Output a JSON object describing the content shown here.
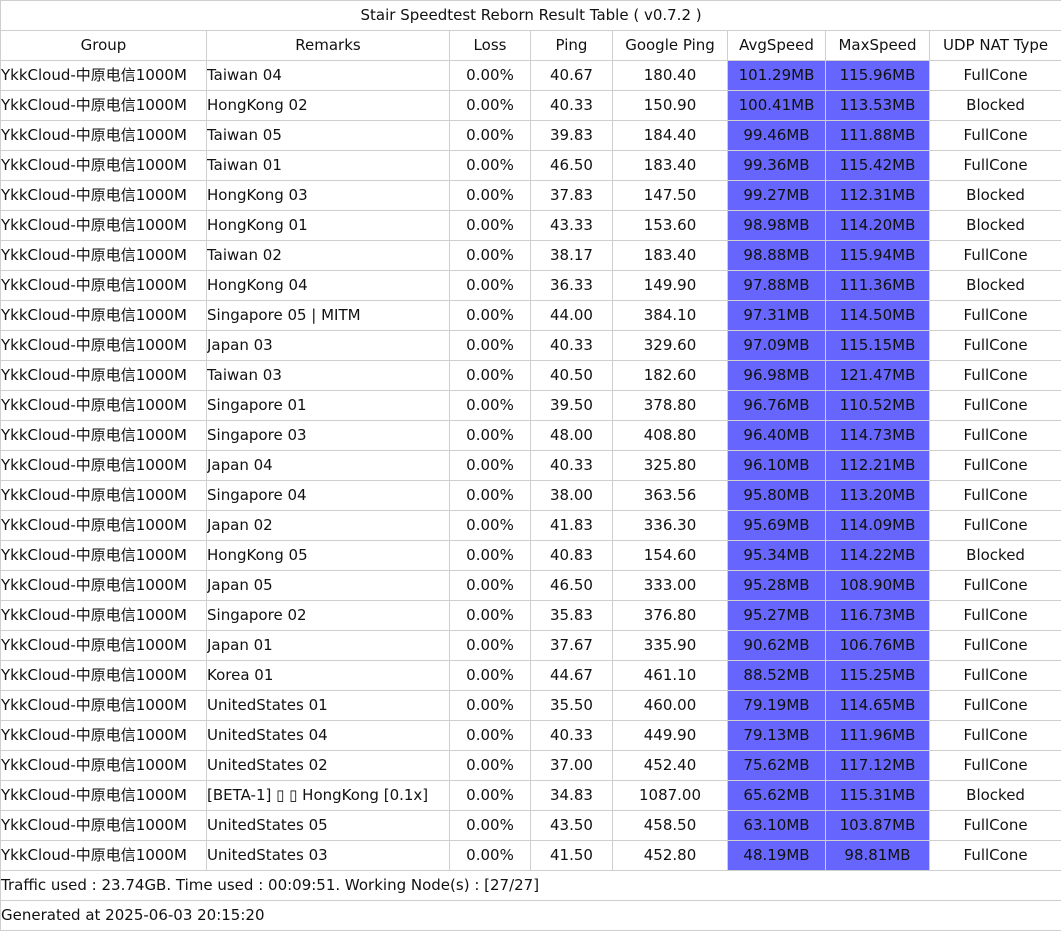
{
  "title": "Stair Speedtest Reborn Result Table ( v0.7.2 )",
  "headers": [
    "Group",
    "Remarks",
    "Loss",
    "Ping",
    "Google Ping",
    "AvgSpeed",
    "MaxSpeed",
    "UDP NAT Type"
  ],
  "speed_cell_color": "#6666ff",
  "rows": [
    {
      "group": "YkkCloud-中原电信1000M",
      "remarks": "Taiwan 04",
      "loss": "0.00%",
      "ping": "40.67",
      "google_ping": "180.40",
      "avg_speed": "101.29MB",
      "max_speed": "115.96MB",
      "nat": "FullCone"
    },
    {
      "group": "YkkCloud-中原电信1000M",
      "remarks": "HongKong 02",
      "loss": "0.00%",
      "ping": "40.33",
      "google_ping": "150.90",
      "avg_speed": "100.41MB",
      "max_speed": "113.53MB",
      "nat": "Blocked"
    },
    {
      "group": "YkkCloud-中原电信1000M",
      "remarks": "Taiwan 05",
      "loss": "0.00%",
      "ping": "39.83",
      "google_ping": "184.40",
      "avg_speed": "99.46MB",
      "max_speed": "111.88MB",
      "nat": "FullCone"
    },
    {
      "group": "YkkCloud-中原电信1000M",
      "remarks": "Taiwan 01",
      "loss": "0.00%",
      "ping": "46.50",
      "google_ping": "183.40",
      "avg_speed": "99.36MB",
      "max_speed": "115.42MB",
      "nat": "FullCone"
    },
    {
      "group": "YkkCloud-中原电信1000M",
      "remarks": "HongKong 03",
      "loss": "0.00%",
      "ping": "37.83",
      "google_ping": "147.50",
      "avg_speed": "99.27MB",
      "max_speed": "112.31MB",
      "nat": "Blocked"
    },
    {
      "group": "YkkCloud-中原电信1000M",
      "remarks": "HongKong 01",
      "loss": "0.00%",
      "ping": "43.33",
      "google_ping": "153.60",
      "avg_speed": "98.98MB",
      "max_speed": "114.20MB",
      "nat": "Blocked"
    },
    {
      "group": "YkkCloud-中原电信1000M",
      "remarks": "Taiwan 02",
      "loss": "0.00%",
      "ping": "38.17",
      "google_ping": "183.40",
      "avg_speed": "98.88MB",
      "max_speed": "115.94MB",
      "nat": "FullCone"
    },
    {
      "group": "YkkCloud-中原电信1000M",
      "remarks": "HongKong 04",
      "loss": "0.00%",
      "ping": "36.33",
      "google_ping": "149.90",
      "avg_speed": "97.88MB",
      "max_speed": "111.36MB",
      "nat": "Blocked"
    },
    {
      "group": "YkkCloud-中原电信1000M",
      "remarks": "Singapore 05 | MITM",
      "loss": "0.00%",
      "ping": "44.00",
      "google_ping": "384.10",
      "avg_speed": "97.31MB",
      "max_speed": "114.50MB",
      "nat": "FullCone"
    },
    {
      "group": "YkkCloud-中原电信1000M",
      "remarks": "Japan 03",
      "loss": "0.00%",
      "ping": "40.33",
      "google_ping": "329.60",
      "avg_speed": "97.09MB",
      "max_speed": "115.15MB",
      "nat": "FullCone"
    },
    {
      "group": "YkkCloud-中原电信1000M",
      "remarks": "Taiwan 03",
      "loss": "0.00%",
      "ping": "40.50",
      "google_ping": "182.60",
      "avg_speed": "96.98MB",
      "max_speed": "121.47MB",
      "nat": "FullCone"
    },
    {
      "group": "YkkCloud-中原电信1000M",
      "remarks": "Singapore 01",
      "loss": "0.00%",
      "ping": "39.50",
      "google_ping": "378.80",
      "avg_speed": "96.76MB",
      "max_speed": "110.52MB",
      "nat": "FullCone"
    },
    {
      "group": "YkkCloud-中原电信1000M",
      "remarks": "Singapore 03",
      "loss": "0.00%",
      "ping": "48.00",
      "google_ping": "408.80",
      "avg_speed": "96.40MB",
      "max_speed": "114.73MB",
      "nat": "FullCone"
    },
    {
      "group": "YkkCloud-中原电信1000M",
      "remarks": "Japan 04",
      "loss": "0.00%",
      "ping": "40.33",
      "google_ping": "325.80",
      "avg_speed": "96.10MB",
      "max_speed": "112.21MB",
      "nat": "FullCone"
    },
    {
      "group": "YkkCloud-中原电信1000M",
      "remarks": "Singapore 04",
      "loss": "0.00%",
      "ping": "38.00",
      "google_ping": "363.56",
      "avg_speed": "95.80MB",
      "max_speed": "113.20MB",
      "nat": "FullCone"
    },
    {
      "group": "YkkCloud-中原电信1000M",
      "remarks": "Japan 02",
      "loss": "0.00%",
      "ping": "41.83",
      "google_ping": "336.30",
      "avg_speed": "95.69MB",
      "max_speed": "114.09MB",
      "nat": "FullCone"
    },
    {
      "group": "YkkCloud-中原电信1000M",
      "remarks": "HongKong 05",
      "loss": "0.00%",
      "ping": "40.83",
      "google_ping": "154.60",
      "avg_speed": "95.34MB",
      "max_speed": "114.22MB",
      "nat": "Blocked"
    },
    {
      "group": "YkkCloud-中原电信1000M",
      "remarks": "Japan 05",
      "loss": "0.00%",
      "ping": "46.50",
      "google_ping": "333.00",
      "avg_speed": "95.28MB",
      "max_speed": "108.90MB",
      "nat": "FullCone"
    },
    {
      "group": "YkkCloud-中原电信1000M",
      "remarks": "Singapore 02",
      "loss": "0.00%",
      "ping": "35.83",
      "google_ping": "376.80",
      "avg_speed": "95.27MB",
      "max_speed": "116.73MB",
      "nat": "FullCone"
    },
    {
      "group": "YkkCloud-中原电信1000M",
      "remarks": "Japan 01",
      "loss": "0.00%",
      "ping": "37.67",
      "google_ping": "335.90",
      "avg_speed": "90.62MB",
      "max_speed": "106.76MB",
      "nat": "FullCone"
    },
    {
      "group": "YkkCloud-中原电信1000M",
      "remarks": "Korea 01",
      "loss": "0.00%",
      "ping": "44.67",
      "google_ping": "461.10",
      "avg_speed": "88.52MB",
      "max_speed": "115.25MB",
      "nat": "FullCone"
    },
    {
      "group": "YkkCloud-中原电信1000M",
      "remarks": "UnitedStates 01",
      "loss": "0.00%",
      "ping": "35.50",
      "google_ping": "460.00",
      "avg_speed": "79.19MB",
      "max_speed": "114.65MB",
      "nat": "FullCone"
    },
    {
      "group": "YkkCloud-中原电信1000M",
      "remarks": "UnitedStates 04",
      "loss": "0.00%",
      "ping": "40.33",
      "google_ping": "449.90",
      "avg_speed": "79.13MB",
      "max_speed": "111.96MB",
      "nat": "FullCone"
    },
    {
      "group": "YkkCloud-中原电信1000M",
      "remarks": "UnitedStates 02",
      "loss": "0.00%",
      "ping": "37.00",
      "google_ping": "452.40",
      "avg_speed": "75.62MB",
      "max_speed": "117.12MB",
      "nat": "FullCone"
    },
    {
      "group": "YkkCloud-中原电信1000M",
      "remarks": "[BETA-1] ▯ ▯ HongKong [0.1x]",
      "loss": "0.00%",
      "ping": "34.83",
      "google_ping": "1087.00",
      "avg_speed": "65.62MB",
      "max_speed": "115.31MB",
      "nat": "Blocked"
    },
    {
      "group": "YkkCloud-中原电信1000M",
      "remarks": "UnitedStates 05",
      "loss": "0.00%",
      "ping": "43.50",
      "google_ping": "458.50",
      "avg_speed": "63.10MB",
      "max_speed": "103.87MB",
      "nat": "FullCone"
    },
    {
      "group": "YkkCloud-中原电信1000M",
      "remarks": "UnitedStates 03",
      "loss": "0.00%",
      "ping": "41.50",
      "google_ping": "452.80",
      "avg_speed": "48.19MB",
      "max_speed": "98.81MB",
      "nat": "FullCone"
    }
  ],
  "footer": {
    "traffic": "Traffic used : 23.74GB. Time used : 00:09:51. Working Node(s) : [27/27]",
    "generated": "Generated at 2025-06-03 20:15:20"
  }
}
